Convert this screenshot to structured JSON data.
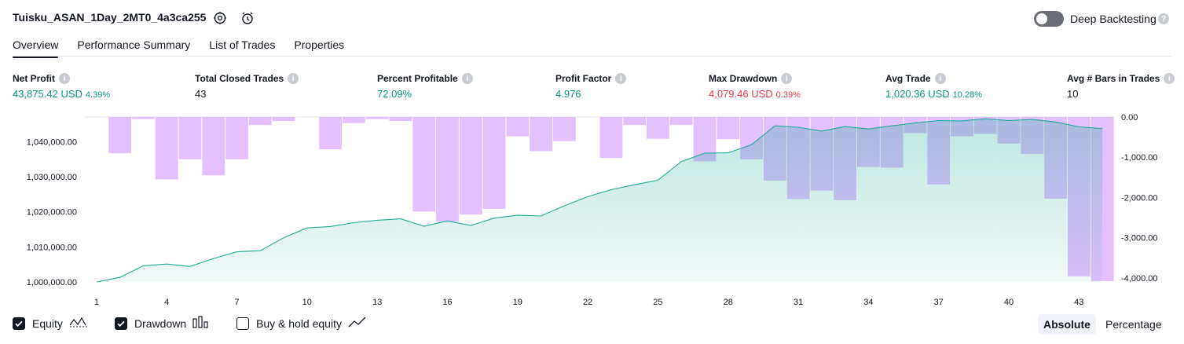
{
  "header": {
    "title": "Tuisku_ASAN_1Day_2MT0_4a3ca255",
    "deep_backtesting_label": "Deep Backtesting",
    "deep_backtesting_on": false
  },
  "tabs": [
    "Overview",
    "Performance Summary",
    "List of Trades",
    "Properties"
  ],
  "active_tab": "Overview",
  "metrics": {
    "net_profit": {
      "label": "Net Profit",
      "value": "43,875.42 USD",
      "pct": "4.39%"
    },
    "total_closed_trades": {
      "label": "Total Closed Trades",
      "value": "43"
    },
    "percent_profitable": {
      "label": "Percent Profitable",
      "value": "72.09%"
    },
    "profit_factor": {
      "label": "Profit Factor",
      "value": "4.976"
    },
    "max_drawdown": {
      "label": "Max Drawdown",
      "value": "4,079.46 USD",
      "pct": "0.39%"
    },
    "avg_trade": {
      "label": "Avg Trade",
      "value": "1,020.36 USD",
      "pct": "10.28%"
    },
    "avg_bars": {
      "label": "Avg # Bars in Trades",
      "value": "10"
    }
  },
  "legend": {
    "equity": {
      "label": "Equity",
      "checked": true
    },
    "drawdown": {
      "label": "Drawdown",
      "checked": true
    },
    "buy_hold": {
      "label": "Buy & hold equity",
      "checked": false
    }
  },
  "view_modes": {
    "absolute": "Absolute",
    "percentage": "Percentage",
    "active": "Absolute"
  },
  "colors": {
    "equity_line": "#22ab94",
    "drawdown_bar": "#ce93ff",
    "profit": "#089981",
    "loss": "#f23645"
  },
  "chart_data": {
    "type": "line",
    "x_ticks": [
      1,
      4,
      7,
      10,
      13,
      16,
      19,
      22,
      25,
      28,
      31,
      34,
      37,
      40,
      43
    ],
    "x_range": [
      1,
      44
    ],
    "left_axis": {
      "ticks": [
        "1,000,000.00",
        "1,010,000.00",
        "1,020,000.00",
        "1,030,000.00",
        "1,040,000.00"
      ],
      "range": [
        1000000,
        1047000
      ]
    },
    "right_axis": {
      "ticks": [
        "0.00",
        "-1,000.00",
        "-2,000.00",
        "-3,000.00",
        "-4,000.00"
      ],
      "range": [
        -4100,
        0
      ]
    },
    "series": [
      {
        "name": "Equity",
        "type": "area",
        "values": [
          1000000,
          1001300,
          1004600,
          1005100,
          1004400,
          1006700,
          1008600,
          1008900,
          1012600,
          1015400,
          1015800,
          1016900,
          1017600,
          1018000,
          1015900,
          1017400,
          1016100,
          1018200,
          1019000,
          1018800,
          1021700,
          1024300,
          1026300,
          1027700,
          1029000,
          1034300,
          1036700,
          1036800,
          1039100,
          1044500,
          1044100,
          1043000,
          1044300,
          1043600,
          1044500,
          1045300,
          1046000,
          1045900,
          1046500,
          1046000,
          1046300,
          1045600,
          1044200,
          1043700
        ]
      },
      {
        "name": "Drawdown",
        "type": "bar",
        "values": [
          0,
          -900,
          -50,
          -1550,
          -1050,
          -1450,
          -1050,
          -200,
          -100,
          0,
          -800,
          -150,
          -50,
          -100,
          -2350,
          -2600,
          -2420,
          -2280,
          -480,
          -850,
          -600,
          0,
          -1020,
          -200,
          -540,
          -200,
          -1100,
          -550,
          -1050,
          -1580,
          -2040,
          -1830,
          -2070,
          -1240,
          -1260,
          -400,
          -1680,
          -480,
          -420,
          -660,
          -920,
          -2030,
          -3960,
          -4079
        ]
      }
    ]
  }
}
